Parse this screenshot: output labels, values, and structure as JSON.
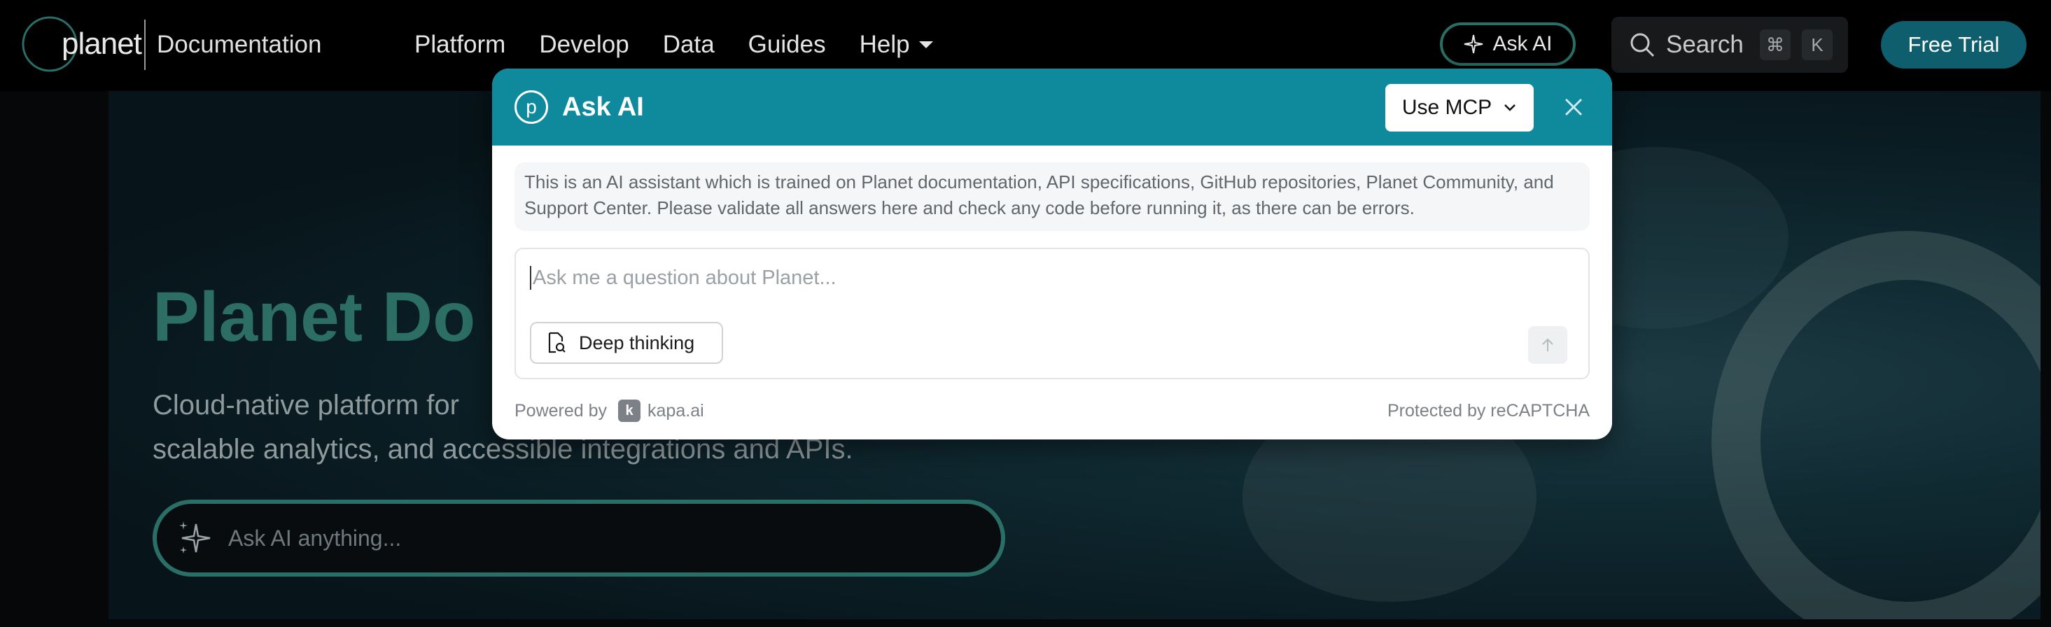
{
  "nav": {
    "logo_text": "planet",
    "title": "Documentation",
    "menu": [
      {
        "label": "Platform"
      },
      {
        "label": "Develop"
      },
      {
        "label": "Data"
      },
      {
        "label": "Guides"
      },
      {
        "label": "Help",
        "icon": "chevron-down-icon"
      }
    ],
    "ask_ai_label": "Ask AI",
    "search_label": "Search",
    "shortcut_keys": [
      "⌘",
      "K"
    ],
    "trial_label": "Free Trial"
  },
  "hero": {
    "title": "Planet Do",
    "subtitle_line1": "Cloud-native platform for",
    "subtitle_line2": "scalable analytics, and accessible integrations and APIs.",
    "ask_placeholder": "Ask AI anything..."
  },
  "modal": {
    "title": "Ask AI",
    "mcp_label": "Use MCP",
    "disclaimer": "This is an AI assistant which is trained on Planet documentation, API specifications, GitHub repositories, Planet Community, and Support Center. Please validate all answers here and check any code before running it, as there can be errors.",
    "input_placeholder": "Ask me a question about Planet...",
    "deep_thinking_label": "Deep thinking",
    "powered_by": "Powered by",
    "kapa_badge": "k",
    "kapa_label": "kapa.ai",
    "protected_by": "Protected by reCAPTCHA"
  },
  "colors": {
    "header_teal": "#0e8a9c",
    "accent_green": "#2a6f67",
    "trial_button": "#0f5e6e",
    "hero_title": "#2c6e63"
  }
}
